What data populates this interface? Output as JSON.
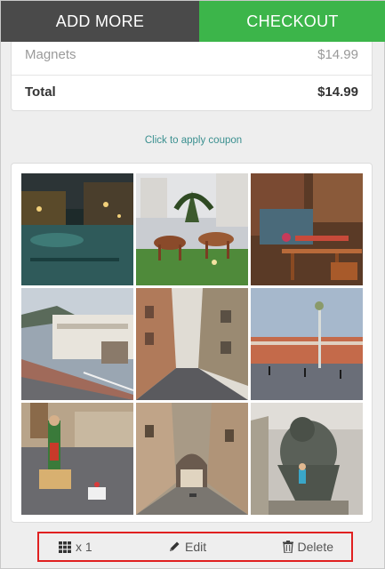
{
  "topbar": {
    "add_more_label": "ADD MORE",
    "checkout_label": "CHECKOUT"
  },
  "summary": {
    "item_name": "Magnets",
    "item_price": "$14.99",
    "total_label": "Total",
    "total_price": "$14.99"
  },
  "coupon_link": "Click to apply coupon",
  "photos": [
    {
      "name": "photo-canal-night"
    },
    {
      "name": "photo-horse-sculptures"
    },
    {
      "name": "photo-canal-cafe"
    },
    {
      "name": "photo-coastal-road"
    },
    {
      "name": "photo-narrow-street"
    },
    {
      "name": "photo-city-square"
    },
    {
      "name": "photo-square-statue"
    },
    {
      "name": "photo-old-town-alley"
    },
    {
      "name": "photo-stone-sculpture"
    }
  ],
  "actions": {
    "quantity_icon": "grid-icon",
    "quantity_label": "x 1",
    "edit_icon": "pencil-icon",
    "edit_label": "Edit",
    "delete_icon": "trash-icon",
    "delete_label": "Delete"
  },
  "colors": {
    "checkout": "#3cb54a",
    "add_more": "#4a4a4a",
    "highlight_box": "#e02020",
    "link": "#3a8f8f"
  }
}
